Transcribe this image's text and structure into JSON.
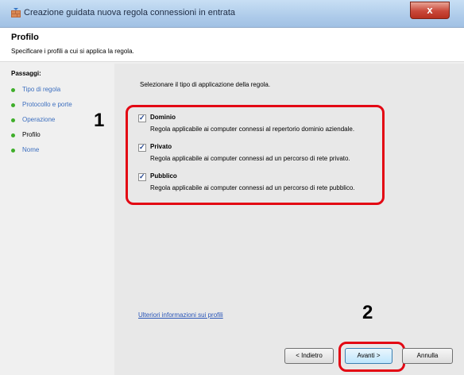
{
  "window": {
    "title": "Creazione guidata nuova regola connessioni in entrata",
    "close_glyph": "x"
  },
  "header": {
    "title": "Profilo",
    "description": "Specificare i profili a cui si applica la regola."
  },
  "sidebar": {
    "label": "Passaggi:",
    "steps": [
      {
        "label": "Tipo di regola"
      },
      {
        "label": "Protocollo e porte"
      },
      {
        "label": "Operazione"
      },
      {
        "label": "Profilo",
        "current": true
      },
      {
        "label": "Nome"
      }
    ]
  },
  "main": {
    "instruction": "Selezionare il tipo di applicazione della regola.",
    "options": [
      {
        "name": "Dominio",
        "description": "Regola applicabile ai computer connessi al repertorio dominio aziendale.",
        "checked": true
      },
      {
        "name": "Privato",
        "description": "Regola applicabile ai computer connessi ad un percorso di rete privato.",
        "checked": true
      },
      {
        "name": "Pubblico",
        "description": "Regola applicabile ai computer connessi ad un percorso di rete pubblico.",
        "checked": true
      }
    ],
    "checkmark_glyph": "✓",
    "help_link": "Ulteriori informazioni sui profili"
  },
  "buttons": {
    "back": "< Indietro",
    "next": "Avanti >",
    "cancel": "Annulla"
  },
  "callouts": {
    "step1": "1",
    "step2": "2"
  },
  "colors": {
    "highlight": "#e30613",
    "link": "#2a56b8",
    "step_bullet": "#3fae2a"
  }
}
